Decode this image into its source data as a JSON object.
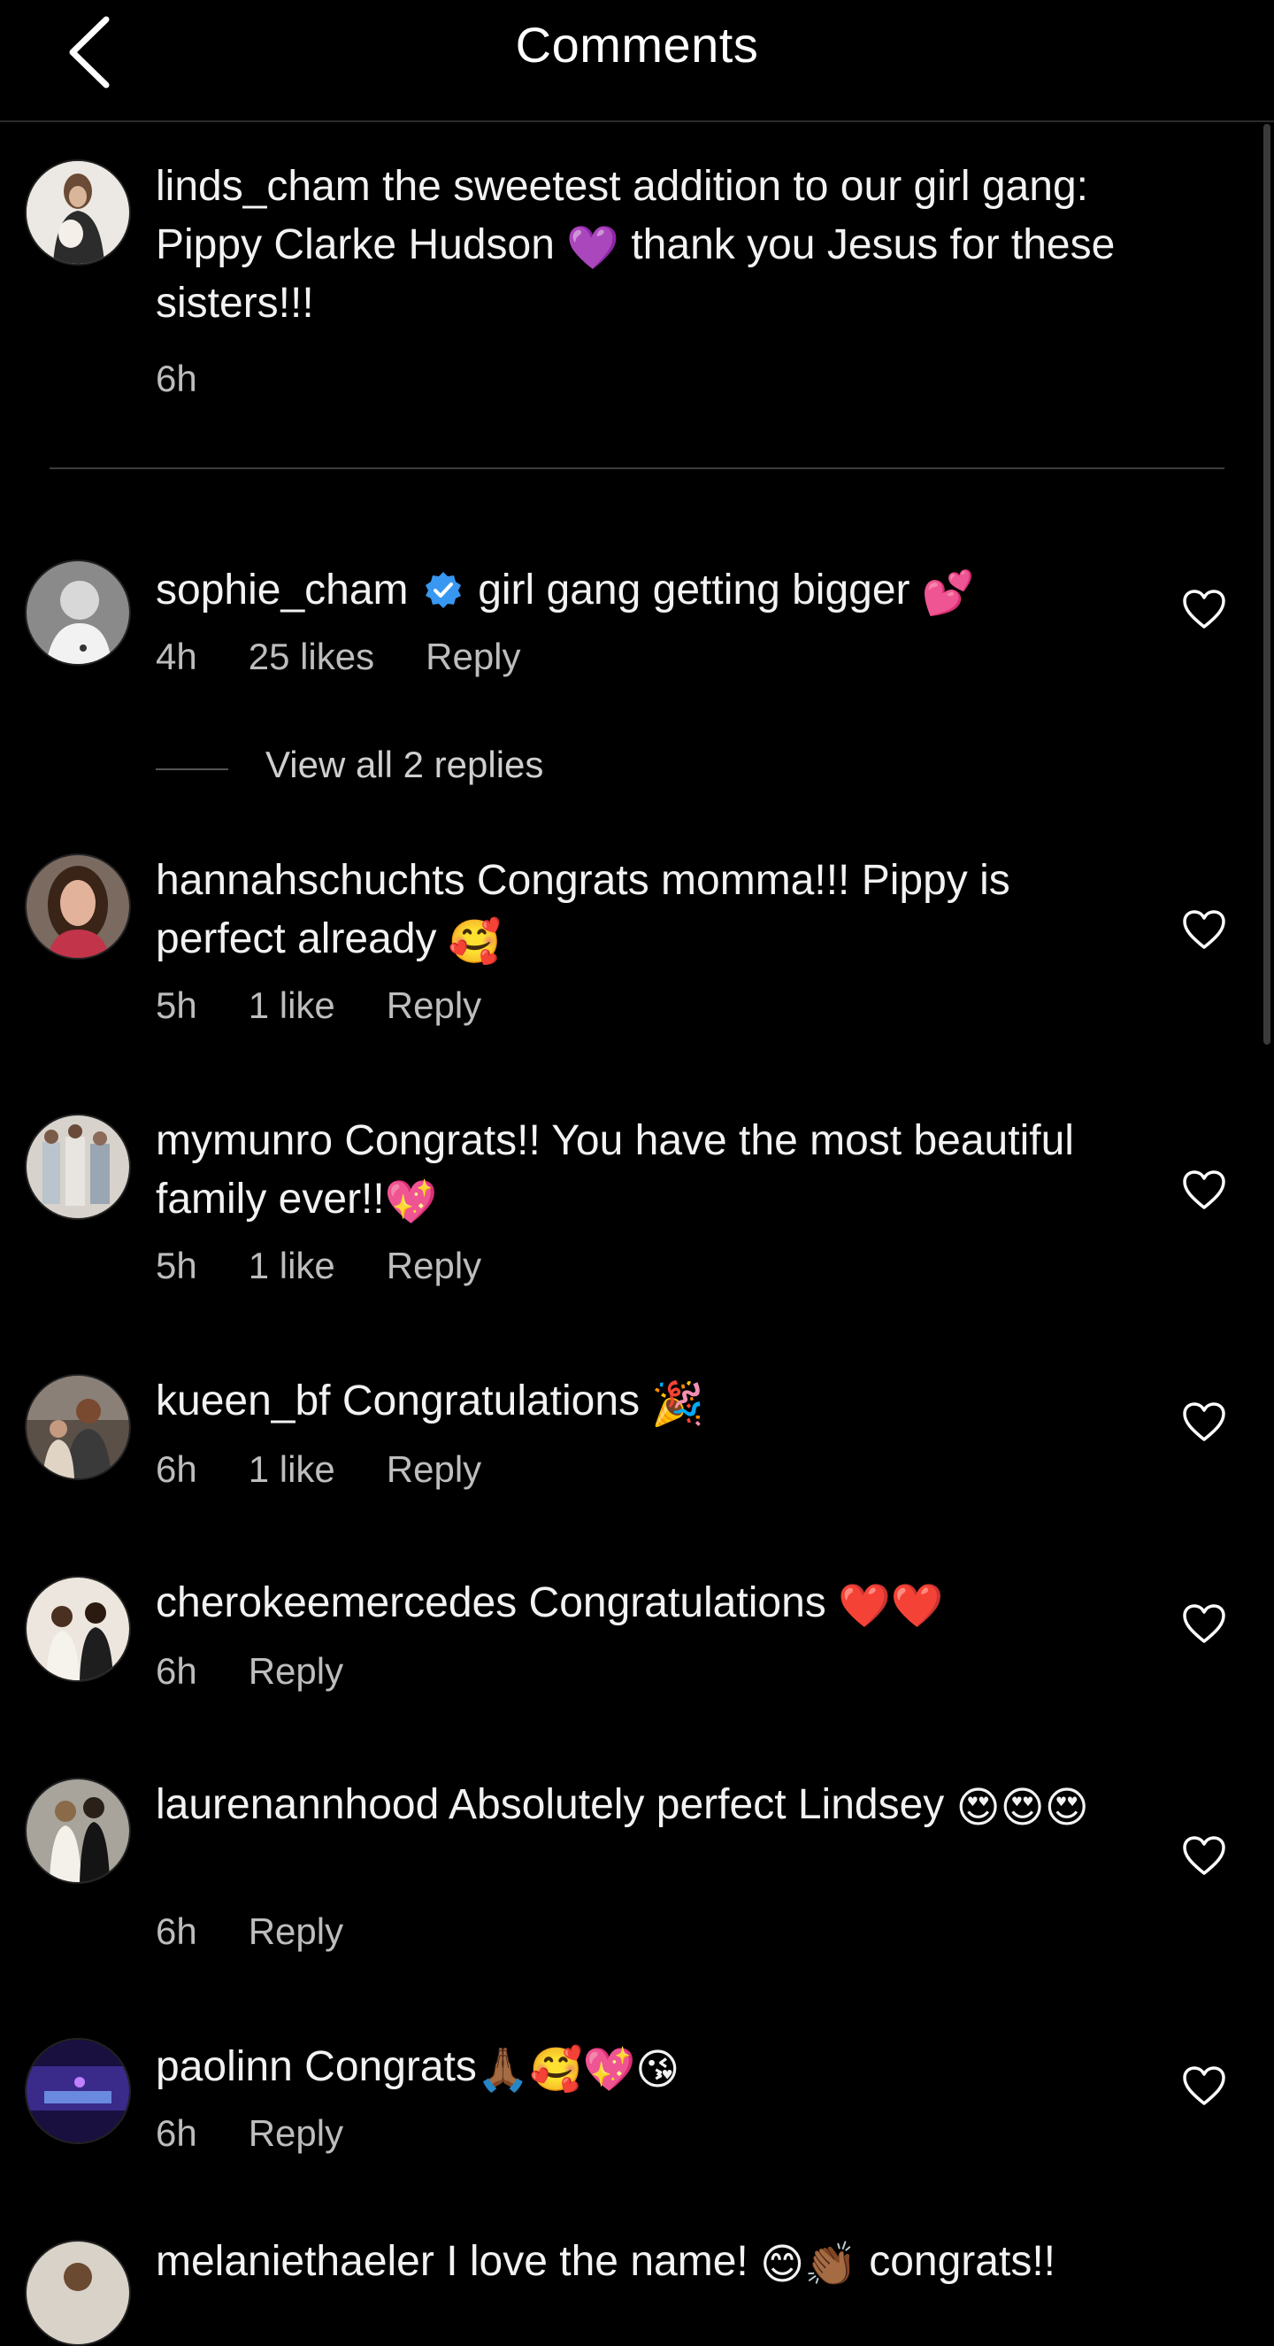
{
  "header": {
    "title": "Comments"
  },
  "caption": {
    "username": "linds_cham",
    "text_before": " the sweetest addition to our girl gang: Pippy Clarke Hudson ",
    "emoji": "💜",
    "text_after": " thank you Jesus for these sisters!!!",
    "time": "6h"
  },
  "comments": [
    {
      "username": "sophie_cham",
      "verified": true,
      "text": " girl gang getting bigger ",
      "emoji": "💕",
      "time": "4h",
      "likes": "25 likes",
      "reply": "Reply"
    },
    {
      "username": "hannahschuchts",
      "text": " Congrats momma!!! Pippy is perfect already ",
      "emoji": "🥰",
      "time": "5h",
      "likes": "1 like",
      "reply": "Reply"
    },
    {
      "username": "mymunro",
      "text": " Congrats!! You have the most beautiful family ever!!",
      "emoji": "💖",
      "time": "5h",
      "likes": "1 like",
      "reply": "Reply"
    },
    {
      "username": "kueen_bf",
      "text": " Congratulations ",
      "emoji": "🎉",
      "time": "6h",
      "likes": "1 like",
      "reply": "Reply"
    },
    {
      "username": "cherokeemercedes",
      "text": " Congratulations ",
      "emoji": "❤️❤️",
      "time": "6h",
      "reply": "Reply"
    },
    {
      "username": "laurenannhood",
      "text": " Absolutely perfect Lindsey ",
      "emoji": "😍😍😍",
      "time": "6h",
      "reply": "Reply"
    },
    {
      "username": "paolinn",
      "text": " Congrats",
      "emoji": "🙏🏾🥰💖😘",
      "time": "6h",
      "reply": "Reply"
    },
    {
      "username": "melaniethaeler",
      "text": " I love the name! ",
      "emoji": "😊👏🏾",
      "text2": " congrats!!"
    }
  ],
  "view_replies": "View all 2 replies",
  "colors": {
    "background": "#000000",
    "text": "#f2f2f2",
    "muted": "#bdbdbd",
    "verified": "#3897f0"
  }
}
